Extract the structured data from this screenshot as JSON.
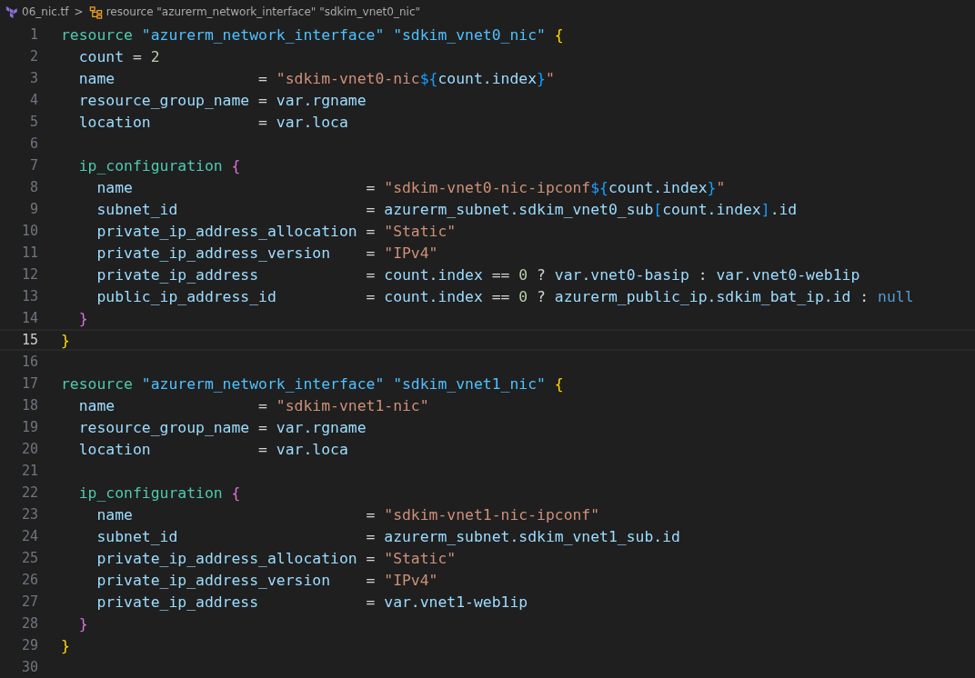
{
  "breadcrumb": {
    "file": "06_nic.tf",
    "separator": ">",
    "symbol": "resource \"azurerm_network_interface\" \"sdkim_vnet0_nic\""
  },
  "lines": [
    {
      "number": "1",
      "current": false,
      "tokens": [
        {
          "kind": "keyword",
          "t": "resource "
        },
        {
          "kind": "label",
          "t": "\"azurerm_network_interface\" "
        },
        {
          "kind": "label",
          "t": "\"sdkim_vnet0_nic\" "
        },
        {
          "kind": "brace",
          "t": "{"
        }
      ]
    },
    {
      "number": "2",
      "current": false,
      "tokens": [
        {
          "kind": "attribute",
          "t": "  count"
        },
        {
          "kind": "operator",
          "t": " = "
        },
        {
          "kind": "number",
          "t": "2"
        }
      ]
    },
    {
      "number": "3",
      "current": false,
      "tokens": [
        {
          "kind": "attribute",
          "t": "  name"
        },
        {
          "kind": "operator",
          "t": "                = "
        },
        {
          "kind": "string",
          "t": "\"sdkim-vnet0-nic"
        },
        {
          "kind": "interpolation",
          "t": "${"
        },
        {
          "kind": "attribute",
          "t": "count.index"
        },
        {
          "kind": "interpolation",
          "t": "}"
        },
        {
          "kind": "string",
          "t": "\""
        }
      ]
    },
    {
      "number": "4",
      "current": false,
      "tokens": [
        {
          "kind": "attribute",
          "t": "  resource_group_name"
        },
        {
          "kind": "operator",
          "t": " = "
        },
        {
          "kind": "attribute",
          "t": "var.rgname"
        }
      ]
    },
    {
      "number": "5",
      "current": false,
      "tokens": [
        {
          "kind": "attribute",
          "t": "  location"
        },
        {
          "kind": "operator",
          "t": "            = "
        },
        {
          "kind": "attribute",
          "t": "var.loca"
        }
      ]
    },
    {
      "number": "6",
      "current": false
    },
    {
      "number": "7",
      "current": false,
      "tokens": [
        {
          "kind": "keyword",
          "t": "  ip_configuration "
        },
        {
          "kind": "nestedbrace",
          "t": "{"
        }
      ]
    },
    {
      "number": "8",
      "current": false,
      "tokens": [
        {
          "kind": "attribute",
          "t": "    name"
        },
        {
          "kind": "operator",
          "t": "                          = "
        },
        {
          "kind": "string",
          "t": "\"sdkim-vnet0-nic-ipconf"
        },
        {
          "kind": "interpolation",
          "t": "${"
        },
        {
          "kind": "attribute",
          "t": "count.index"
        },
        {
          "kind": "interpolation",
          "t": "}"
        },
        {
          "kind": "string",
          "t": "\""
        }
      ]
    },
    {
      "number": "9",
      "current": false,
      "tokens": [
        {
          "kind": "attribute",
          "t": "    subnet_id"
        },
        {
          "kind": "operator",
          "t": "                     = "
        },
        {
          "kind": "attribute",
          "t": "azurerm_subnet.sdkim_vnet0_sub"
        },
        {
          "kind": "interpolation",
          "t": "["
        },
        {
          "kind": "attribute",
          "t": "count.index"
        },
        {
          "kind": "interpolation",
          "t": "]"
        },
        {
          "kind": "attribute",
          "t": ".id"
        }
      ]
    },
    {
      "number": "10",
      "current": false,
      "tokens": [
        {
          "kind": "attribute",
          "t": "    private_ip_address_allocation"
        },
        {
          "kind": "operator",
          "t": " = "
        },
        {
          "kind": "string",
          "t": "\"Static\""
        }
      ]
    },
    {
      "number": "11",
      "current": false,
      "tokens": [
        {
          "kind": "attribute",
          "t": "    private_ip_address_version"
        },
        {
          "kind": "operator",
          "t": "    = "
        },
        {
          "kind": "string",
          "t": "\"IPv4\""
        }
      ]
    },
    {
      "number": "12",
      "current": false,
      "tokens": [
        {
          "kind": "attribute",
          "t": "    private_ip_address"
        },
        {
          "kind": "operator",
          "t": "            = "
        },
        {
          "kind": "attribute",
          "t": "count.index"
        },
        {
          "kind": "operator",
          "t": " == "
        },
        {
          "kind": "number",
          "t": "0"
        },
        {
          "kind": "operator",
          "t": " ? "
        },
        {
          "kind": "attribute",
          "t": "var.vnet0-basip"
        },
        {
          "kind": "operator",
          "t": " : "
        },
        {
          "kind": "attribute",
          "t": "var.vnet0-web1ip"
        }
      ]
    },
    {
      "number": "13",
      "current": false,
      "tokens": [
        {
          "kind": "attribute",
          "t": "    public_ip_address_id"
        },
        {
          "kind": "operator",
          "t": "          = "
        },
        {
          "kind": "attribute",
          "t": "count.index"
        },
        {
          "kind": "operator",
          "t": " == "
        },
        {
          "kind": "number",
          "t": "0"
        },
        {
          "kind": "operator",
          "t": " ? "
        },
        {
          "kind": "attribute",
          "t": "azurerm_public_ip.sdkim_bat_ip.id"
        },
        {
          "kind": "operator",
          "t": " : "
        },
        {
          "kind": "null",
          "t": "null"
        }
      ]
    },
    {
      "number": "14",
      "current": false,
      "tokens": [
        {
          "kind": "nestedbrace",
          "t": "  }"
        }
      ]
    },
    {
      "number": "15",
      "current": true,
      "tokens": [
        {
          "kind": "brace",
          "t": "}"
        }
      ]
    },
    {
      "number": "16",
      "current": false
    },
    {
      "number": "17",
      "current": false,
      "tokens": [
        {
          "kind": "keyword",
          "t": "resource "
        },
        {
          "kind": "label",
          "t": "\"azurerm_network_interface\" "
        },
        {
          "kind": "label",
          "t": "\"sdkim_vnet1_nic\" "
        },
        {
          "kind": "brace",
          "t": "{"
        }
      ]
    },
    {
      "number": "18",
      "current": false,
      "tokens": [
        {
          "kind": "attribute",
          "t": "  name"
        },
        {
          "kind": "operator",
          "t": "                = "
        },
        {
          "kind": "string",
          "t": "\"sdkim-vnet1-nic\""
        }
      ]
    },
    {
      "number": "19",
      "current": false,
      "tokens": [
        {
          "kind": "attribute",
          "t": "  resource_group_name"
        },
        {
          "kind": "operator",
          "t": " = "
        },
        {
          "kind": "attribute",
          "t": "var.rgname"
        }
      ]
    },
    {
      "number": "20",
      "current": false,
      "tokens": [
        {
          "kind": "attribute",
          "t": "  location"
        },
        {
          "kind": "operator",
          "t": "            = "
        },
        {
          "kind": "attribute",
          "t": "var.loca"
        }
      ]
    },
    {
      "number": "21",
      "current": false
    },
    {
      "number": "22",
      "current": false,
      "tokens": [
        {
          "kind": "keyword",
          "t": "  ip_configuration "
        },
        {
          "kind": "nestedbrace",
          "t": "{"
        }
      ]
    },
    {
      "number": "23",
      "current": false,
      "tokens": [
        {
          "kind": "attribute",
          "t": "    name"
        },
        {
          "kind": "operator",
          "t": "                          = "
        },
        {
          "kind": "string",
          "t": "\"sdkim-vnet1-nic-ipconf\""
        }
      ]
    },
    {
      "number": "24",
      "current": false,
      "tokens": [
        {
          "kind": "attribute",
          "t": "    subnet_id"
        },
        {
          "kind": "operator",
          "t": "                     = "
        },
        {
          "kind": "attribute",
          "t": "azurerm_subnet.sdkim_vnet1_sub.id"
        }
      ]
    },
    {
      "number": "25",
      "current": false,
      "tokens": [
        {
          "kind": "attribute",
          "t": "    private_ip_address_allocation"
        },
        {
          "kind": "operator",
          "t": " = "
        },
        {
          "kind": "string",
          "t": "\"Static\""
        }
      ]
    },
    {
      "number": "26",
      "current": false,
      "tokens": [
        {
          "kind": "attribute",
          "t": "    private_ip_address_version"
        },
        {
          "kind": "operator",
          "t": "    = "
        },
        {
          "kind": "string",
          "t": "\"IPv4\""
        }
      ]
    },
    {
      "number": "27",
      "current": false,
      "tokens": [
        {
          "kind": "attribute",
          "t": "    private_ip_address"
        },
        {
          "kind": "operator",
          "t": "            = "
        },
        {
          "kind": "attribute",
          "t": "var.vnet1-web1ip"
        }
      ]
    },
    {
      "number": "28",
      "current": false,
      "tokens": [
        {
          "kind": "nestedbrace",
          "t": "  }"
        }
      ]
    },
    {
      "number": "29",
      "current": false,
      "tokens": [
        {
          "kind": "brace",
          "t": "}"
        }
      ]
    },
    {
      "number": "30",
      "current": false
    }
  ]
}
